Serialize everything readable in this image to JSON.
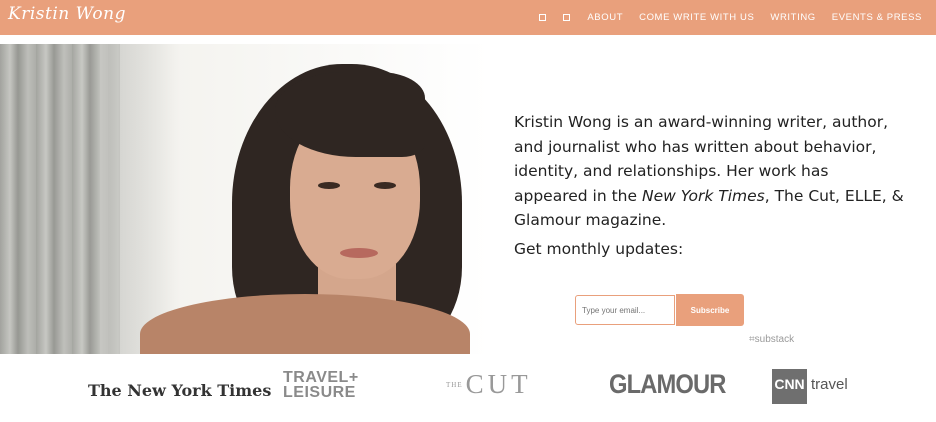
{
  "header": {
    "logo_text": "Kristin Wong",
    "nav": [
      "ABOUT",
      "COME WRITE WITH US",
      "WRITING",
      "EVENTS & PRESS"
    ],
    "nav_icons": [
      "square-icon",
      "square-icon"
    ],
    "background_color": "#e9a07c"
  },
  "bio": {
    "text_before": "Kristin Wong is an award-winning writer, author, and journalist who has written about behavior, identity, and relationships. Her work has appeared in the ",
    "emphasis": "New York Times",
    "text_after": ", The Cut, ELLE, & Glamour magazine.",
    "updates_label": "Get monthly updates:"
  },
  "subscribe": {
    "email_placeholder": "Type your email...",
    "button_label": "Subscribe",
    "powered_by": "substack"
  },
  "press": {
    "nyt": "The New York Times",
    "tl_line1": "TRAVEL+",
    "tl_line2": "LEISURE",
    "cut_prefix": "THE",
    "cut_main": "CUT",
    "glamour": "GLAMOUR",
    "cnn_box": "CNN",
    "cnn_travel": "travel"
  }
}
